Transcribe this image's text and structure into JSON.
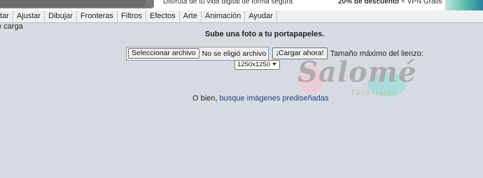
{
  "ad": {
    "left_text": "Disfruta de tu vida digital de forma segura",
    "right_bold": "20% de descuento",
    "right_light": " + VPN Gratis"
  },
  "menu": {
    "items": [
      "tar",
      "Ajustar",
      "Dibujar",
      "Fronteras",
      "Filtros",
      "Efectos",
      "Arte",
      "Animación",
      "Ayudar"
    ]
  },
  "page": {
    "left_label": "e carga",
    "heading": "Sube una foto a tu portapapeles.",
    "file_button": "Seleccionar archivo",
    "file_status": "No se eligió archivo",
    "upload_button": "¡Cargar ahora!",
    "canvas_label": "Tamaño máximo del lienzo:",
    "canvas_size": "1250x1250",
    "alt_prefix": "O bien, ",
    "alt_link": "busque imágenes prediseñadas"
  },
  "watermark": {
    "title": "Salomé",
    "subtitle": "Tutoriales"
  }
}
